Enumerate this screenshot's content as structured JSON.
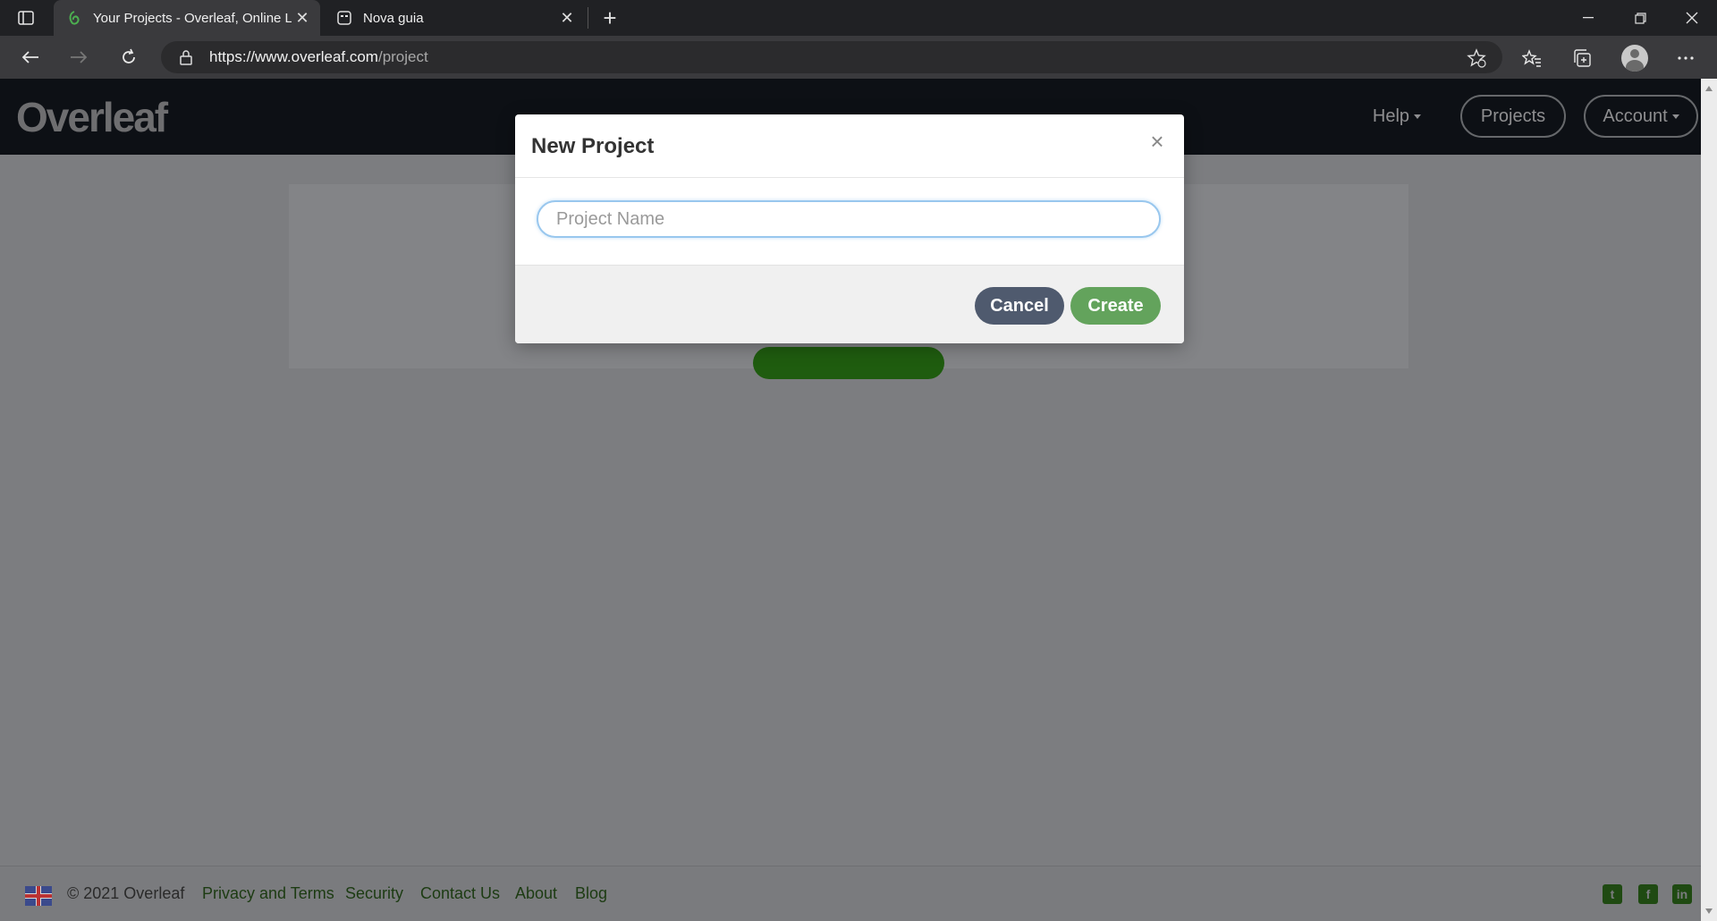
{
  "browser": {
    "tabs": [
      {
        "title": "Your Projects - Overleaf, Online L",
        "active": true,
        "icon": "overleaf-leaf-icon"
      },
      {
        "title": "Nova guia",
        "active": false,
        "icon": "new-tab-page-icon"
      }
    ],
    "url_host": "https://www.overleaf.com",
    "url_path": "/project"
  },
  "site": {
    "logo": "Overleaf",
    "nav": {
      "help": "Help",
      "projects": "Projects",
      "account": "Account"
    }
  },
  "modal": {
    "title": "New Project",
    "close": "×",
    "input_placeholder": "Project Name",
    "input_value": "",
    "cancel": "Cancel",
    "create": "Create"
  },
  "footer": {
    "copyright": "© 2021 Overleaf",
    "links": {
      "privacy": "Privacy and Terms",
      "security": "Security",
      "contact": "Contact Us",
      "about": "About",
      "blog": "Blog"
    },
    "social": [
      "twitter-icon",
      "facebook-icon",
      "linkedin-icon"
    ]
  },
  "colors": {
    "accent_green": "#63a35c",
    "cancel_button": "#4f5a6e",
    "nav_background": "#0d1015",
    "overlay_gray": "#7c7d80"
  }
}
